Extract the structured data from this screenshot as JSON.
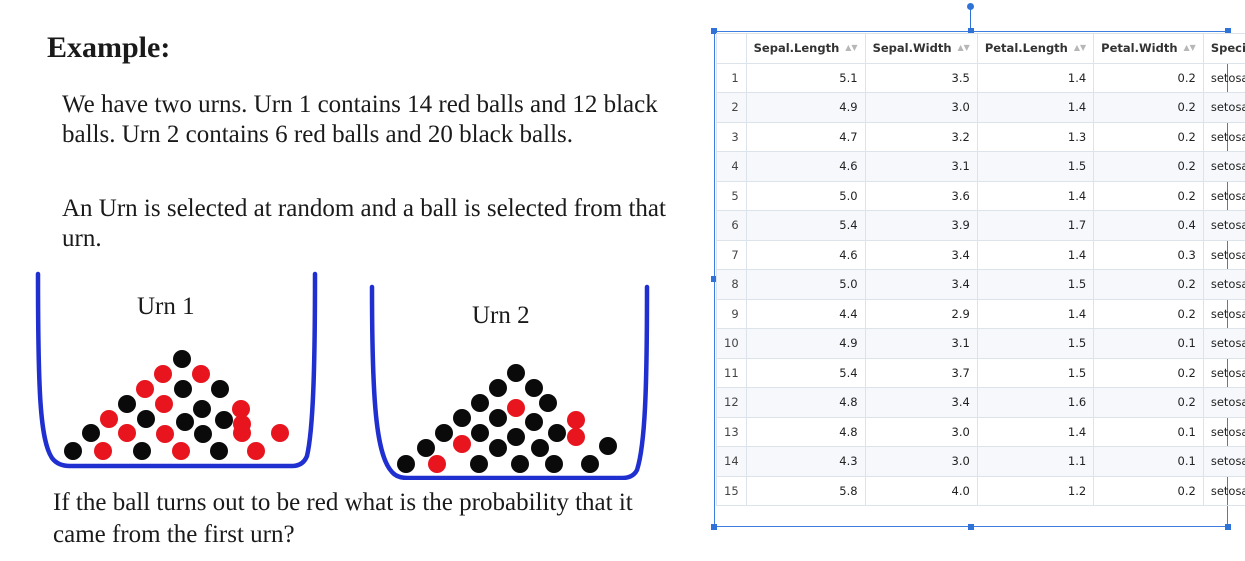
{
  "slide": {
    "heading": "Example:",
    "paragraph1": "We have two urns. Urn 1 contains 14 red balls and 12 black balls. Urn 2 contains 6 red balls and 20 black balls.",
    "paragraph2": "An Urn is selected at random and a ball is selected from that urn.",
    "question": "If the ball turns out to be red what is the probability that it came from the first urn?",
    "urn1_label": "Urn 1",
    "urn2_label": "Urn 2",
    "urn1": {
      "red": 14,
      "black": 12
    },
    "urn2": {
      "red": 6,
      "black": 20
    }
  },
  "colors": {
    "urn_outline": "#1f2fd0",
    "ball_red": "#e8141e",
    "ball_black": "#0a0a0a",
    "selection_border": "#3d7de0"
  },
  "table": {
    "columns": [
      "Sepal.Length",
      "Sepal.Width",
      "Petal.Length",
      "Petal.Width",
      "Species"
    ],
    "rows": [
      [
        "1",
        "5.1",
        "3.5",
        "1.4",
        "0.2",
        "setosa"
      ],
      [
        "2",
        "4.9",
        "3.0",
        "1.4",
        "0.2",
        "setosa"
      ],
      [
        "3",
        "4.7",
        "3.2",
        "1.3",
        "0.2",
        "setosa"
      ],
      [
        "4",
        "4.6",
        "3.1",
        "1.5",
        "0.2",
        "setosa"
      ],
      [
        "5",
        "5.0",
        "3.6",
        "1.4",
        "0.2",
        "setosa"
      ],
      [
        "6",
        "5.4",
        "3.9",
        "1.7",
        "0.4",
        "setosa"
      ],
      [
        "7",
        "4.6",
        "3.4",
        "1.4",
        "0.3",
        "setosa"
      ],
      [
        "8",
        "5.0",
        "3.4",
        "1.5",
        "0.2",
        "setosa"
      ],
      [
        "9",
        "4.4",
        "2.9",
        "1.4",
        "0.2",
        "setosa"
      ],
      [
        "10",
        "4.9",
        "3.1",
        "1.5",
        "0.1",
        "setosa"
      ],
      [
        "11",
        "5.4",
        "3.7",
        "1.5",
        "0.2",
        "setosa"
      ],
      [
        "12",
        "4.8",
        "3.4",
        "1.6",
        "0.2",
        "setosa"
      ],
      [
        "13",
        "4.8",
        "3.0",
        "1.4",
        "0.1",
        "setosa"
      ],
      [
        "14",
        "4.3",
        "3.0",
        "1.1",
        "0.1",
        "setosa"
      ],
      [
        "15",
        "5.8",
        "4.0",
        "1.2",
        "0.2",
        "setosa"
      ]
    ]
  }
}
